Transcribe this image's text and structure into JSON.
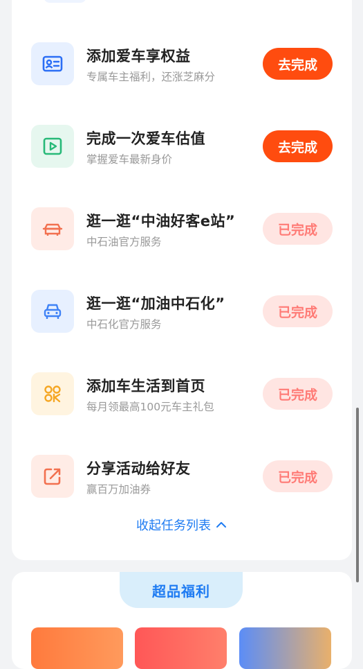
{
  "tasks": [
    {
      "title": "添加爱车享权益",
      "subtitle": "专属车主福利，还涨芝麻分",
      "button": "去完成",
      "state": "todo",
      "icon": "id-card-icon",
      "icon_bg": "#e7f0ff",
      "icon_color": "#2b6ef5"
    },
    {
      "title": "完成一次爱车估值",
      "subtitle": "掌握爱车最新身价",
      "button": "去完成",
      "state": "todo",
      "icon": "play-icon",
      "icon_bg": "#e6f7ef",
      "icon_color": "#27b978"
    },
    {
      "title": "逛一逛“中油好客e站”",
      "subtitle": "中石油官方服务",
      "button": "已完成",
      "state": "done",
      "icon": "car-front-icon",
      "icon_bg": "#ffebe6",
      "icon_color": "#f2704f"
    },
    {
      "title": "逛一逛“加油中石化”",
      "subtitle": "中石化官方服务",
      "button": "已完成",
      "state": "done",
      "icon": "car-icon",
      "icon_bg": "#e7f0ff",
      "icon_color": "#3f82f6"
    },
    {
      "title": "添加车生活到首页",
      "subtitle": "每月领最高100元车主礼包",
      "button": "已完成",
      "state": "done",
      "icon": "apps-icon",
      "icon_bg": "#fff4e0",
      "icon_color": "#f5a623"
    },
    {
      "title": "分享活动给好友",
      "subtitle": "赢百万加油券",
      "button": "已完成",
      "state": "done",
      "icon": "share-icon",
      "icon_bg": "#ffece6",
      "icon_color": "#f2704f"
    }
  ],
  "collapse_label": "收起任务列表",
  "welfare_title": "超品福利",
  "colors": {
    "accent": "#ff4c0f",
    "done_bg": "#ffe5e2",
    "done_text": "#ff7b76",
    "link": "#1e7bf2"
  }
}
